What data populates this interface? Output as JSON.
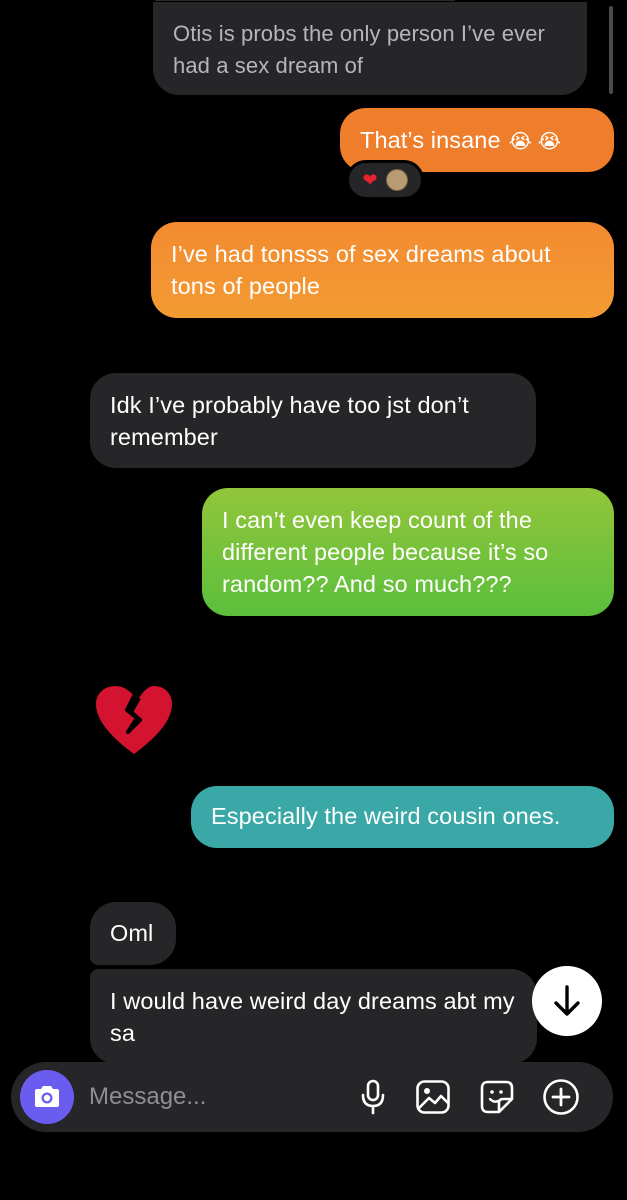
{
  "messages": [
    {
      "id": "m1",
      "side": "incoming",
      "text": "Otis is probs the only person I’ve ever had a sex dream of"
    },
    {
      "id": "m2",
      "side": "outgoing",
      "text": "That’s insane",
      "emoji": "😭 😭",
      "reactions": [
        "heart",
        "face-sticker"
      ]
    },
    {
      "id": "m3",
      "side": "outgoing",
      "text": "I’ve had tonsss of sex dreams about tons of people"
    },
    {
      "id": "m4",
      "side": "incoming",
      "text": "Idk I’ve probably have too jst don’t remember"
    },
    {
      "id": "m5",
      "side": "outgoing",
      "text": "I can’t even keep count of the different people because it’s so random?? And so much???"
    },
    {
      "id": "m6",
      "side": "incoming",
      "emoji": "💔"
    },
    {
      "id": "m7",
      "side": "outgoing",
      "text": "Especially the weird cousin ones."
    },
    {
      "id": "m8",
      "side": "incoming",
      "text": "Oml"
    },
    {
      "id": "m9",
      "side": "incoming",
      "text": "I would have weird day dreams abt my sa"
    }
  ],
  "composer": {
    "placeholder": "Message...",
    "icons": [
      "camera-icon",
      "microphone-icon",
      "gallery-icon",
      "sticker-icon",
      "plus-icon"
    ]
  },
  "colors": {
    "background": "#000000",
    "incoming_bubble": "#262628",
    "outgoing_orange": "#ef7e2c",
    "outgoing_green": "#5bbf3c",
    "outgoing_teal": "#3aa8a6",
    "camera_accent": "#6b5cf0"
  }
}
